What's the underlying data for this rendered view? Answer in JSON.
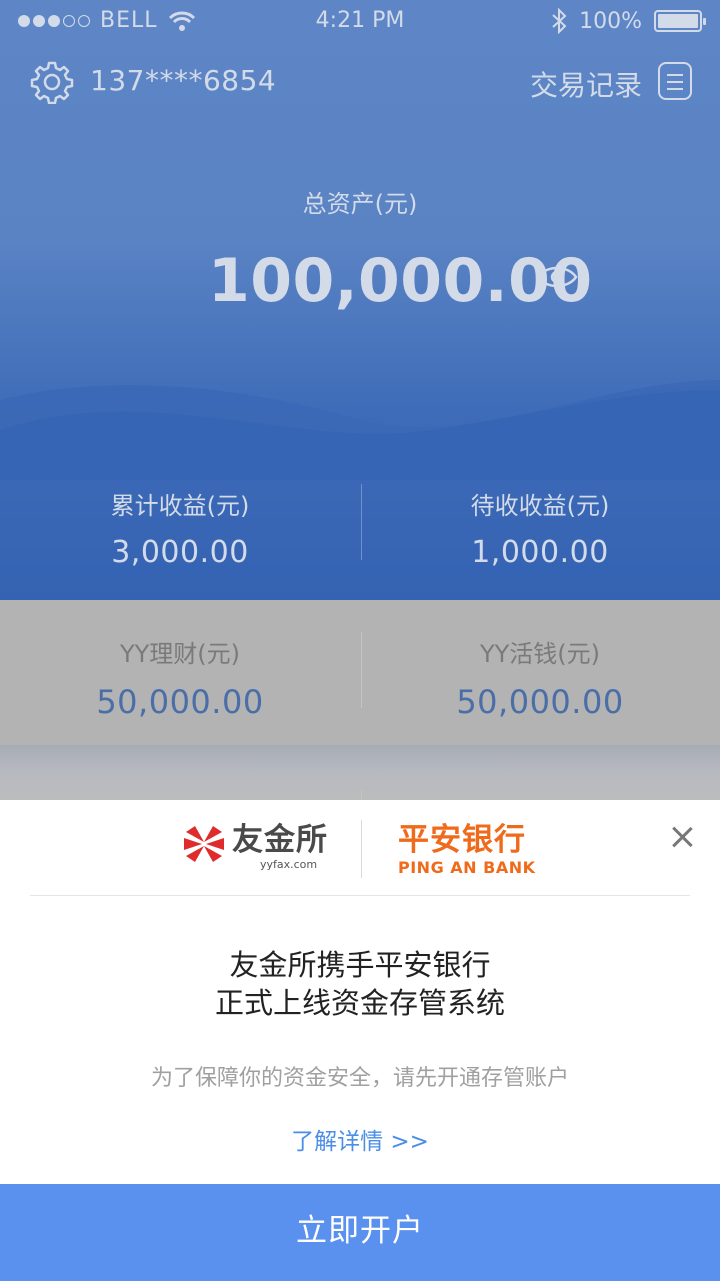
{
  "status": {
    "carrier": "BELL",
    "time": "4:21 PM",
    "battery": "100%"
  },
  "header": {
    "phone": "137****6854",
    "records_label": "交易记录"
  },
  "assets": {
    "total_label": "总资产(元)",
    "total_value": "100,000.00"
  },
  "earnings": [
    {
      "label": "累计收益(元)",
      "value": "3,000.00"
    },
    {
      "label": "待收收益(元)",
      "value": "1,000.00"
    }
  ],
  "products": [
    {
      "label": "YY理财(元)",
      "value": "50,000.00"
    },
    {
      "label": "YY活钱(元)",
      "value": "50,000.00"
    }
  ],
  "sheet": {
    "logo_yy_cn": "友金所",
    "logo_yy_en": "yyfax.com",
    "logo_pa_cn": "平安银行",
    "logo_pa_en": "PING AN BANK",
    "headline_1": "友金所携手平安银行",
    "headline_2": "正式上线资金存管系统",
    "subtitle": "为了保障你的资金安全，请先开通存管账户",
    "details_link": "了解详情 >>",
    "cta": "立即开户"
  },
  "colors": {
    "primary_blue": "#3563b3",
    "cta_blue": "#5a91ef",
    "link_blue": "#4a8ee8",
    "brand_orange": "#ef6a1b",
    "brand_red": "#e02b2b"
  }
}
